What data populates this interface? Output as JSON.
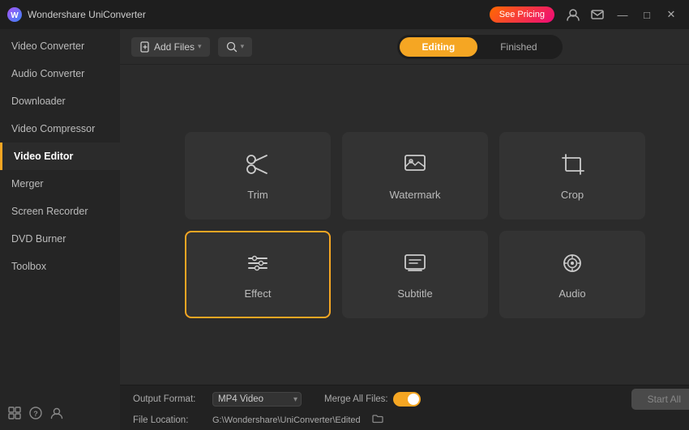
{
  "app": {
    "title": "Wondershare UniConverter",
    "see_pricing_label": "See Pricing"
  },
  "titlebar": {
    "controls": {
      "minimize": "—",
      "maximize": "□",
      "close": "✕"
    }
  },
  "sidebar": {
    "items": [
      {
        "id": "video-converter",
        "label": "Video Converter",
        "active": false
      },
      {
        "id": "audio-converter",
        "label": "Audio Converter",
        "active": false
      },
      {
        "id": "downloader",
        "label": "Downloader",
        "active": false
      },
      {
        "id": "video-compressor",
        "label": "Video Compressor",
        "active": false
      },
      {
        "id": "video-editor",
        "label": "Video Editor",
        "active": true
      },
      {
        "id": "merger",
        "label": "Merger",
        "active": false
      },
      {
        "id": "screen-recorder",
        "label": "Screen Recorder",
        "active": false
      },
      {
        "id": "dvd-burner",
        "label": "DVD Burner",
        "active": false
      },
      {
        "id": "toolbox",
        "label": "Toolbox",
        "active": false
      }
    ]
  },
  "toolbar": {
    "add_btn_label": "Add Files",
    "search_btn_label": "Search"
  },
  "tabs": [
    {
      "id": "editing",
      "label": "Editing",
      "active": true
    },
    {
      "id": "finished",
      "label": "Finished",
      "active": false
    }
  ],
  "tools": [
    {
      "id": "trim",
      "label": "Trim",
      "icon": "scissors",
      "selected": false
    },
    {
      "id": "watermark",
      "label": "Watermark",
      "icon": "watermark",
      "selected": false
    },
    {
      "id": "crop",
      "label": "Crop",
      "icon": "crop",
      "selected": false
    },
    {
      "id": "effect",
      "label": "Effect",
      "icon": "effect",
      "selected": true
    },
    {
      "id": "subtitle",
      "label": "Subtitle",
      "icon": "subtitle",
      "selected": false
    },
    {
      "id": "audio",
      "label": "Audio",
      "icon": "audio",
      "selected": false
    }
  ],
  "bottom_bar": {
    "output_format_label": "Output Format:",
    "output_format_value": "MP4 Video",
    "merge_label": "Merge All Files:",
    "file_location_label": "File Location:",
    "file_location_value": "G:\\Wondershare\\UniConverter\\Edited",
    "start_btn_label": "Start All"
  },
  "colors": {
    "accent": "#f5a623",
    "active_border": "#f5a623"
  }
}
